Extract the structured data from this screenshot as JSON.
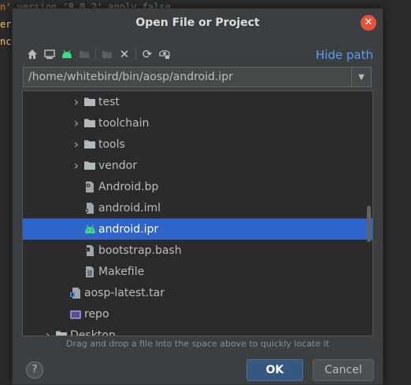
{
  "background_code": [
    {
      "prefix": "n'",
      "text": " version '8.0.2' apply false"
    },
    {
      "prefix": "er",
      "text": ""
    },
    {
      "prefix": "nc",
      "text": ""
    }
  ],
  "dialog": {
    "title": "Open File or Project",
    "hide_path_label": "Hide path",
    "path_value": "/home/whitebird/bin/aosp/android.ipr",
    "drag_hint": "Drag and drop a file into the space above to quickly locate it",
    "help_label": "?",
    "ok_label": "OK",
    "cancel_label": "Cancel",
    "toolbar_icons": [
      "home-icon",
      "desktop-icon",
      "android-project-icon",
      "module-folder-icon",
      "new-folder-icon",
      "delete-icon",
      "refresh-icon",
      "show-hidden-icon"
    ]
  },
  "tree": {
    "rows": [
      {
        "label": "test",
        "icon": "folder-icon",
        "type": "folder",
        "depth": 2,
        "selected": false
      },
      {
        "label": "toolchain",
        "icon": "folder-icon",
        "type": "folder",
        "depth": 2,
        "selected": false
      },
      {
        "label": "tools",
        "icon": "folder-icon",
        "type": "folder",
        "depth": 2,
        "selected": false
      },
      {
        "label": "vendor",
        "icon": "folder-icon",
        "type": "folder",
        "depth": 2,
        "selected": false
      },
      {
        "label": "Android.bp",
        "icon": "config-file-icon",
        "type": "file",
        "depth": 2,
        "selected": false
      },
      {
        "label": "android.iml",
        "icon": "module-file-icon",
        "type": "file",
        "depth": 2,
        "selected": false
      },
      {
        "label": "android.ipr",
        "icon": "android-icon",
        "type": "file",
        "depth": 2,
        "selected": true
      },
      {
        "label": "bootstrap.bash",
        "icon": "script-file-icon",
        "type": "file",
        "depth": 2,
        "selected": false
      },
      {
        "label": "Makefile",
        "icon": "text-file-icon",
        "type": "file",
        "depth": 2,
        "selected": false
      },
      {
        "label": "aosp-latest.tar",
        "icon": "archive-file-icon",
        "type": "file",
        "depth": 1,
        "selected": false
      },
      {
        "label": "repo",
        "icon": "exec-file-icon",
        "type": "file",
        "depth": 1,
        "selected": false
      },
      {
        "label": "Desktop",
        "icon": "folder-icon",
        "type": "folder",
        "depth": 0,
        "selected": false
      }
    ]
  },
  "colors": {
    "accent": "#589df6",
    "selection": "#2f65ca",
    "close": "#e5533a",
    "android": "#3ddc84"
  }
}
